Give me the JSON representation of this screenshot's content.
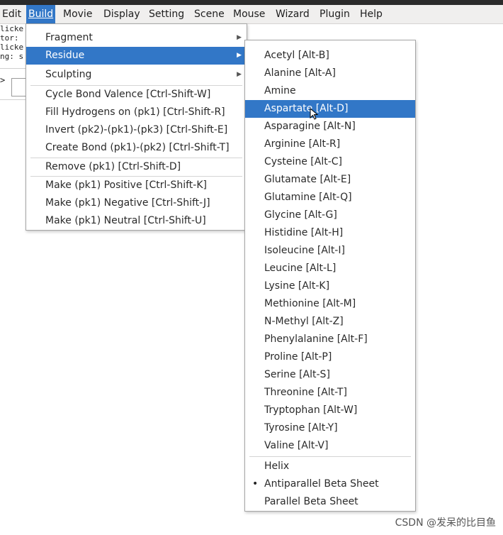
{
  "menubar": {
    "items": [
      "Edit",
      "Build",
      "Movie",
      "Display",
      "Setting",
      "Scene",
      "Mouse",
      "Wizard",
      "Plugin",
      "Help"
    ],
    "active": "Build"
  },
  "console": {
    "lines": [
      "licke",
      "tor:",
      "licke",
      "ng: s"
    ],
    "prompt": ">"
  },
  "build_menu": {
    "items": [
      {
        "label": "Fragment",
        "submenu": true
      },
      {
        "label": "Residue",
        "submenu": true,
        "highlighted": true
      },
      {
        "label": "Sculpting",
        "submenu": true
      },
      {
        "label": "Cycle Bond Valence [Ctrl-Shift-W]"
      },
      {
        "label": "Fill Hydrogens on (pk1) [Ctrl-Shift-R]"
      },
      {
        "label": "Invert (pk2)-(pk1)-(pk3) [Ctrl-Shift-E]"
      },
      {
        "label": "Create Bond (pk1)-(pk2) [Ctrl-Shift-T]"
      },
      {
        "label": "Remove (pk1) [Ctrl-Shift-D]"
      },
      {
        "label": "Make (pk1) Positive [Ctrl-Shift-K]"
      },
      {
        "label": "Make (pk1) Negative [Ctrl-Shift-J]"
      },
      {
        "label": "Make (pk1) Neutral [Ctrl-Shift-U]"
      }
    ]
  },
  "residue_menu": {
    "items": [
      {
        "label": "Acetyl [Alt-B]"
      },
      {
        "label": "Alanine [Alt-A]"
      },
      {
        "label": "Amine"
      },
      {
        "label": "Aspartate [Alt-D]",
        "highlighted": true
      },
      {
        "label": "Asparagine [Alt-N]"
      },
      {
        "label": "Arginine [Alt-R]"
      },
      {
        "label": "Cysteine [Alt-C]"
      },
      {
        "label": "Glutamate [Alt-E]"
      },
      {
        "label": "Glutamine [Alt-Q]"
      },
      {
        "label": "Glycine [Alt-G]"
      },
      {
        "label": "Histidine [Alt-H]"
      },
      {
        "label": "Isoleucine [Alt-I]"
      },
      {
        "label": "Leucine [Alt-L]"
      },
      {
        "label": "Lysine [Alt-K]"
      },
      {
        "label": "Methionine [Alt-M]"
      },
      {
        "label": "N-Methyl [Alt-Z]"
      },
      {
        "label": "Phenylalanine [Alt-F]"
      },
      {
        "label": "Proline [Alt-P]"
      },
      {
        "label": "Serine [Alt-S]"
      },
      {
        "label": "Threonine [Alt-T]"
      },
      {
        "label": "Tryptophan [Alt-W]"
      },
      {
        "label": "Tyrosine [Alt-Y]"
      },
      {
        "label": "Valine [Alt-V]"
      },
      {
        "label": "Helix"
      },
      {
        "label": "Antiparallel Beta Sheet",
        "selected": true
      },
      {
        "label": "Parallel Beta Sheet"
      }
    ]
  },
  "watermark": "CSDN @发呆的比目鱼",
  "colors": {
    "highlight": "#3277c7",
    "menubar_bg": "#f0efee"
  }
}
